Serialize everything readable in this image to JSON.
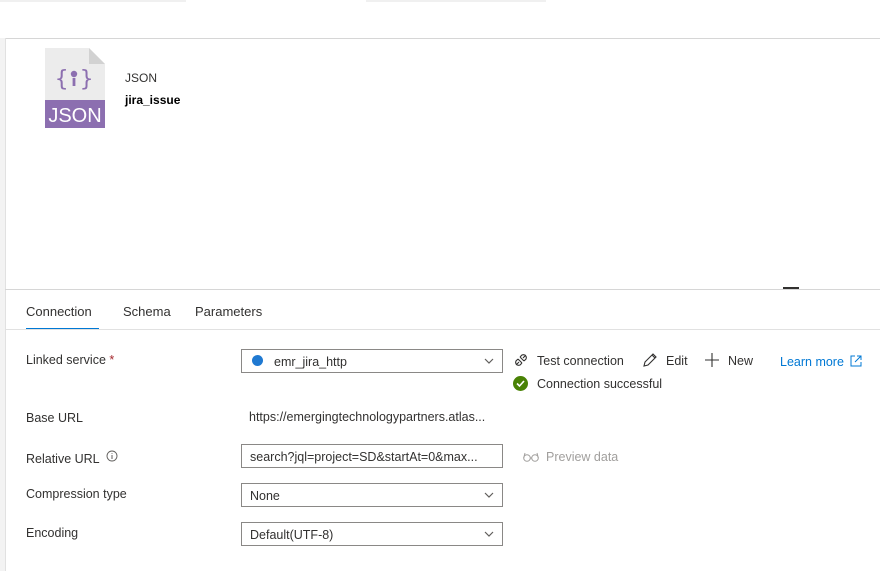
{
  "dataset": {
    "type_label": "JSON",
    "name": "jira_issue",
    "icon_text": "JSON"
  },
  "tabs": [
    {
      "label": "Connection",
      "active": true
    },
    {
      "label": "Schema",
      "active": false
    },
    {
      "label": "Parameters",
      "active": false
    }
  ],
  "form": {
    "linked_service": {
      "label": "Linked service",
      "required_mark": "*",
      "value": "emr_jira_http"
    },
    "base_url": {
      "label": "Base URL",
      "value": "https://emergingtechnologypartners.atlas..."
    },
    "relative_url": {
      "label": "Relative URL",
      "value": "search?jql=project=SD&startAt=0&max..."
    },
    "compression_type": {
      "label": "Compression type",
      "value": "None"
    },
    "encoding": {
      "label": "Encoding",
      "value": "Default(UTF-8)"
    }
  },
  "actions": {
    "test_connection": "Test connection",
    "edit": "Edit",
    "new": "New",
    "learn_more": "Learn more",
    "preview_data": "Preview data"
  },
  "status": {
    "connection": "Connection successful",
    "success_color": "#498205"
  },
  "colors": {
    "accent": "#0078d4",
    "json_icon": "#8c6fb0"
  }
}
